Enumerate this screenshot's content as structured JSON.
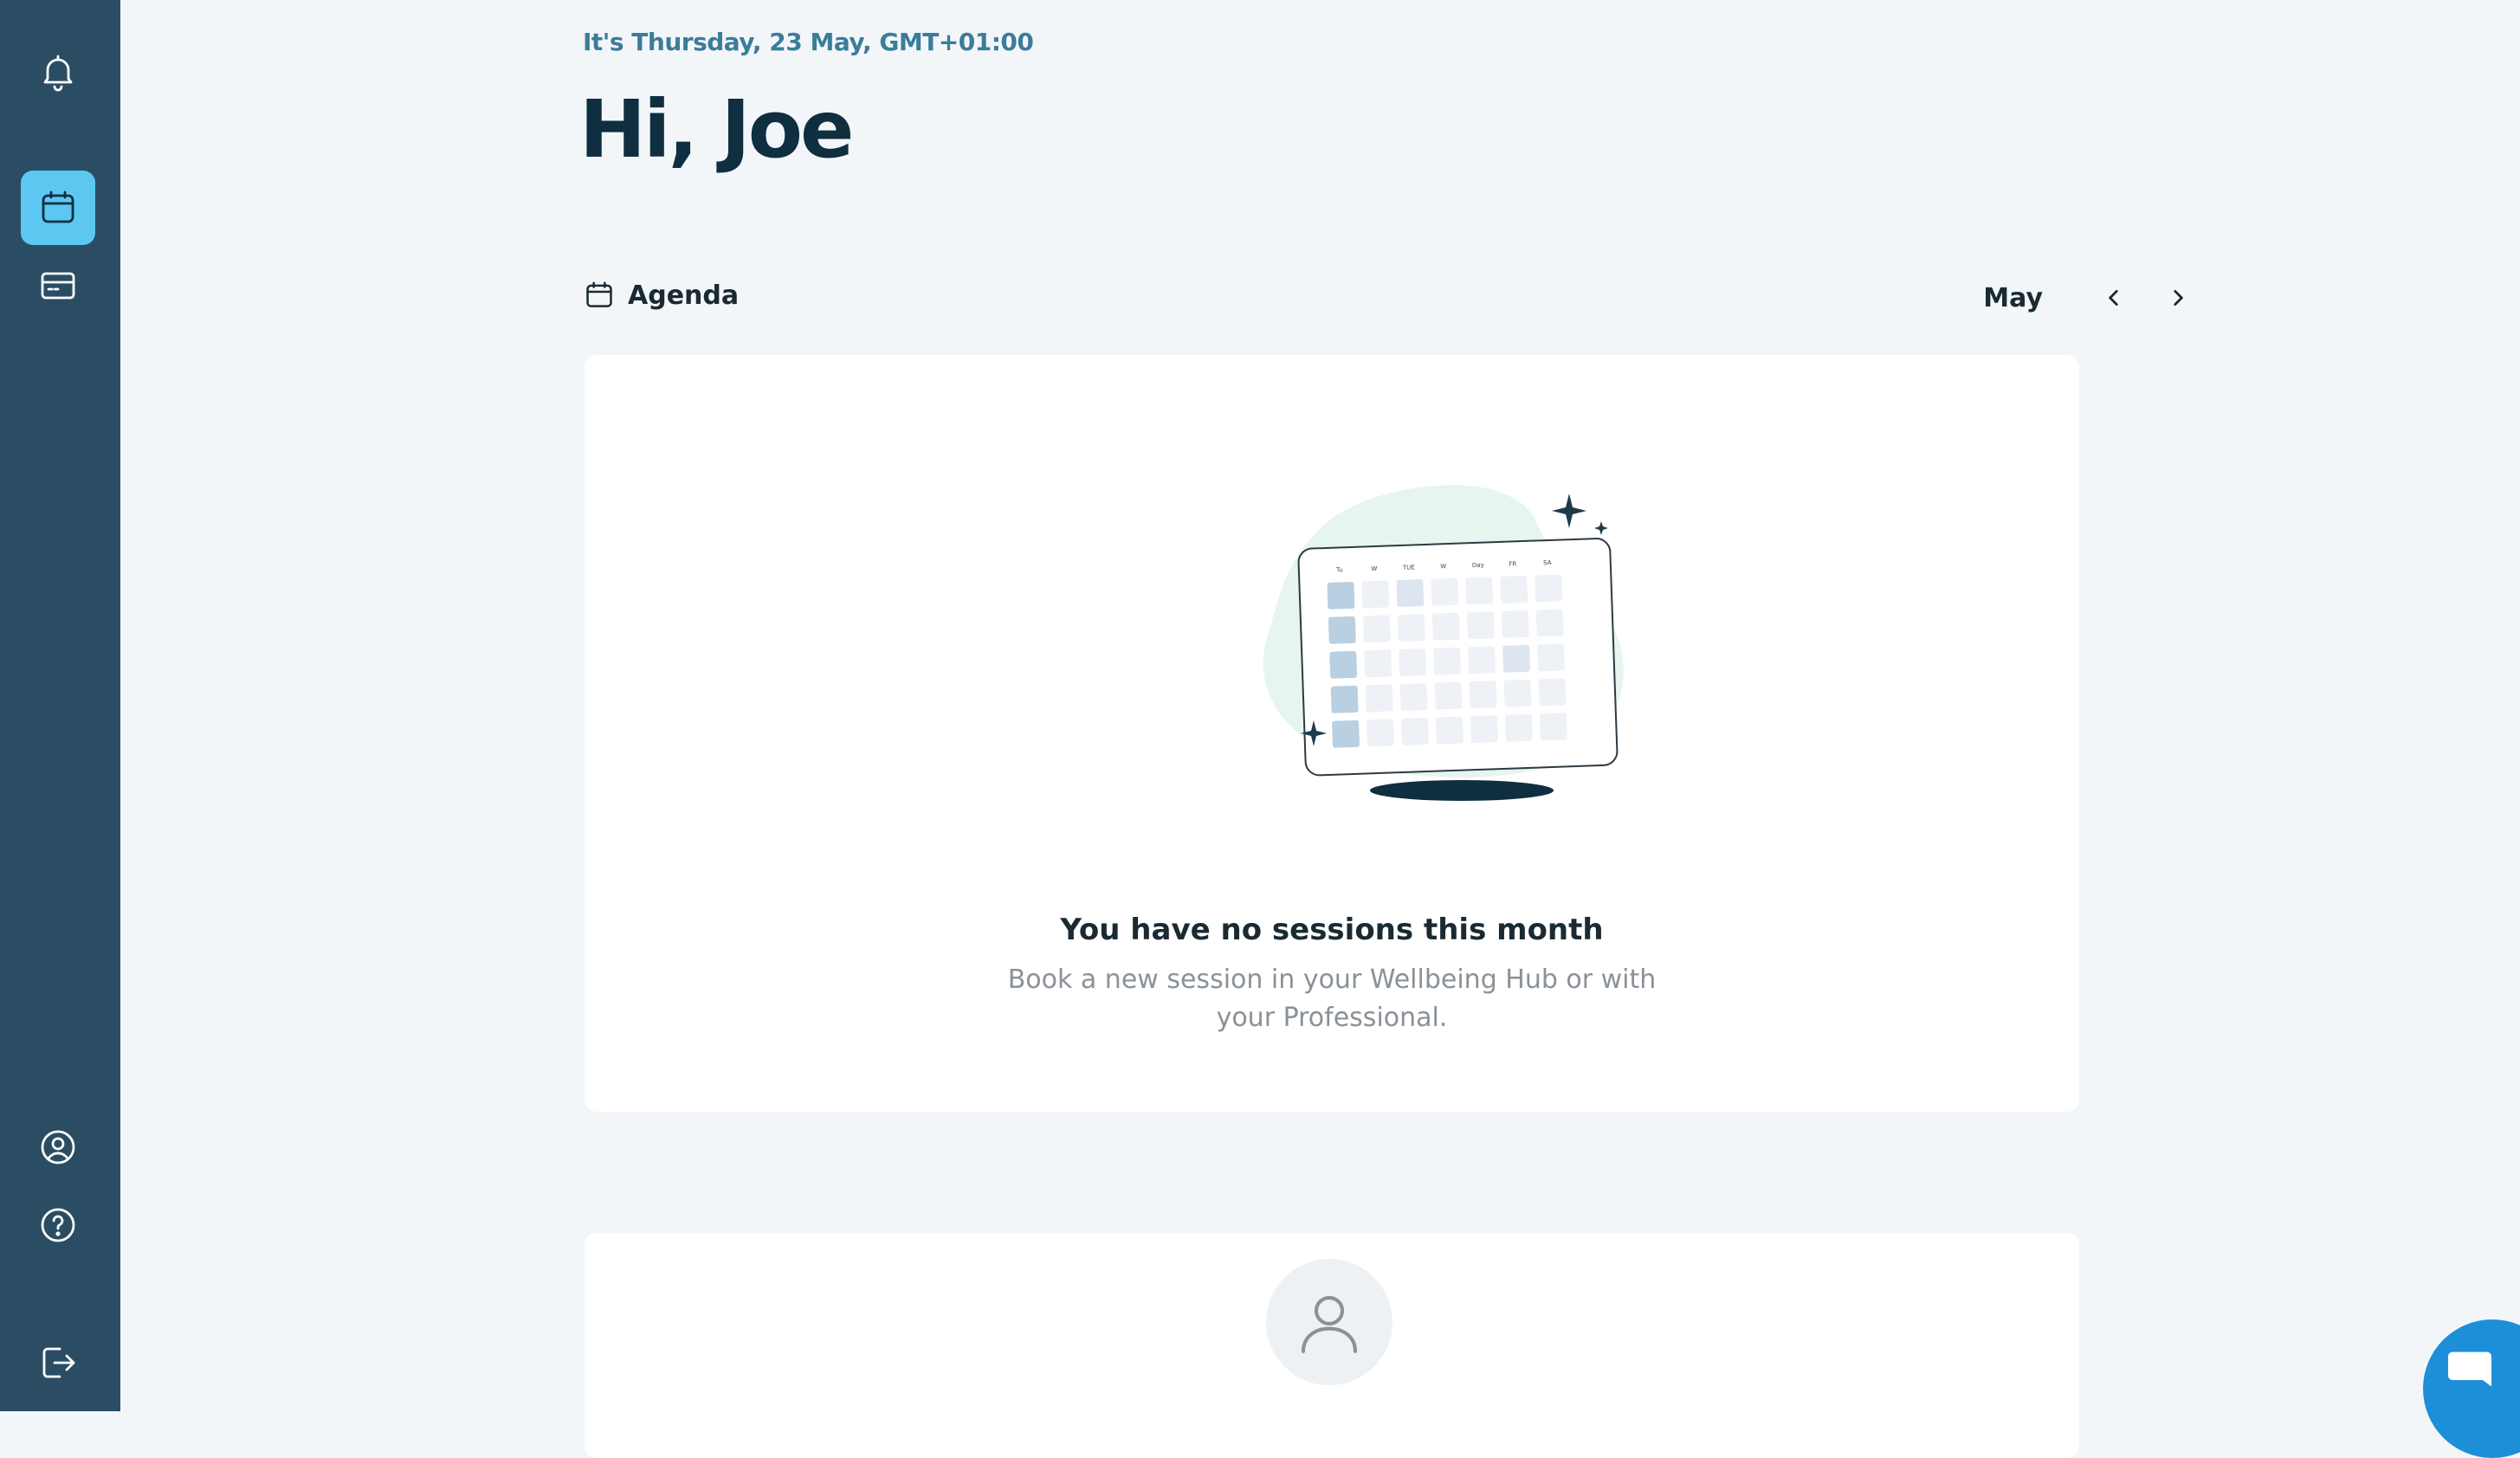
{
  "header": {
    "date_line": "It's Thursday, 23 May, GMT+01:00",
    "greeting": "Hi, Joe"
  },
  "sidebar": {
    "items": [
      {
        "name": "notifications",
        "icon": "bell-icon"
      },
      {
        "name": "agenda",
        "icon": "calendar-icon",
        "active": true
      },
      {
        "name": "payments",
        "icon": "card-icon"
      },
      {
        "name": "profile",
        "icon": "user-circle-icon"
      },
      {
        "name": "help",
        "icon": "question-circle-icon"
      },
      {
        "name": "logout",
        "icon": "logout-icon"
      }
    ]
  },
  "agenda": {
    "title": "Agenda",
    "month": "May",
    "empty_title": "You have no sessions this month",
    "empty_subtitle": "Book a new session in your Wellbeing Hub or with your Professional.",
    "illustration_day_labels": [
      "Tu",
      "W",
      "TUE",
      "W",
      "Day",
      "FR",
      "SA"
    ]
  },
  "colors": {
    "sidebar": "#2b4d63",
    "active_accent": "#5cc8f2",
    "date_text": "#3a7d99",
    "heading": "#0f2f40",
    "chat_button": "#1d8fd9"
  }
}
